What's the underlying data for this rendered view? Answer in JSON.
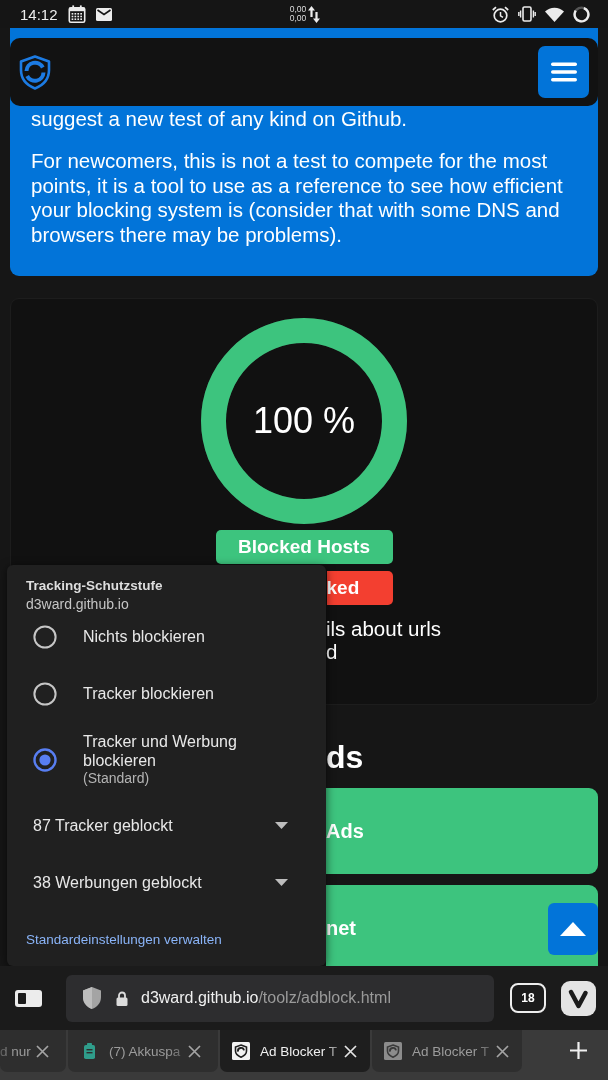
{
  "status_bar": {
    "time": "14:12",
    "data_rate": [
      "0,00",
      "0,00"
    ]
  },
  "intro_card": {
    "line": "suggest a new test of any kind on Github.",
    "paragraph": "For newcomers, this is not a test to compete for the most points, it is a tool to use as a reference to see how efficient your blocking system is (consider that with some DNS and browsers there may be problems)."
  },
  "result_card": {
    "gauge": {
      "label": "100 %",
      "level": 1
    },
    "badges": [
      {
        "label": "Blocked Hosts",
        "color": "#3dc47e"
      },
      {
        "label": "ked",
        "color": "#f33f30"
      }
    ],
    "details": [
      "ils about urls",
      "d"
    ]
  },
  "tests": {
    "heading": "ds",
    "cards": [
      {
        "label": "Ads"
      },
      {
        "label": "net"
      }
    ]
  },
  "tracking_popup": {
    "title": "Tracking-Schutzstufe",
    "site": "d3ward.github.io",
    "options": [
      {
        "label": "Nichts blockieren",
        "selected": false
      },
      {
        "label": "Tracker blockieren",
        "selected": false
      },
      {
        "label": "Tracker und Werbung blockieren",
        "note": "(Standard)",
        "selected": true
      }
    ],
    "counters": [
      {
        "label": "87 Tracker geblockt",
        "expanded": false
      },
      {
        "label": "38 Werbungen geblockt",
        "expanded": false
      }
    ],
    "link": "Standardeinstellungen verwalten"
  },
  "address_bar": {
    "host": "d3ward.github.io",
    "path": "/toolz/adblock.html",
    "tab_count": "18"
  },
  "tabs": [
    {
      "title": "d nur",
      "kind": "clipped",
      "selected": false
    },
    {
      "title": "(7) Akkuspa",
      "kind": "app",
      "selected": false
    },
    {
      "title": "Ad Blocker T",
      "kind": "site",
      "selected": true
    },
    {
      "title": "Ad Blocker T",
      "kind": "site",
      "selected": false
    }
  ]
}
